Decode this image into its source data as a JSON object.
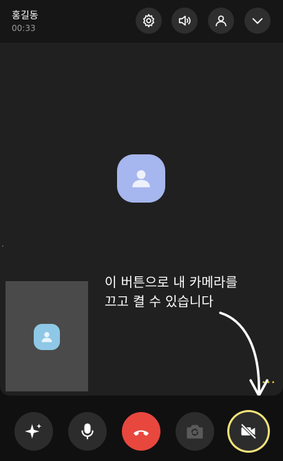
{
  "header": {
    "caller_name": "홍길동",
    "call_timer": "00:33",
    "buttons": [
      "gear-icon",
      "speaker-icon",
      "person-icon",
      "chevron-down-icon"
    ]
  },
  "annotation": {
    "line1": "이 버튼으로 내 카메라를",
    "line2": "끄고 켤 수 있습니다"
  },
  "controls": [
    "sparkle-effects-icon",
    "microphone-icon",
    "end-call-icon",
    "switch-camera-icon",
    "camera-off-icon"
  ],
  "colors": {
    "end_call": "#e8473e",
    "highlight_ring": "#f1e27a",
    "main_avatar": "#a6b6ee",
    "self_avatar": "#8ec8e6"
  }
}
